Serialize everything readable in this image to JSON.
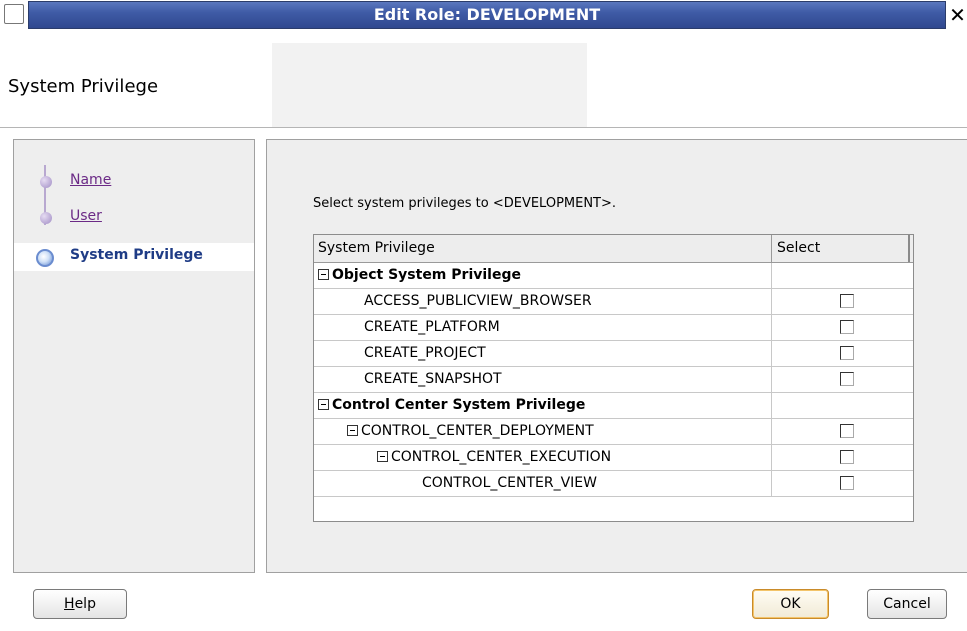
{
  "window": {
    "title": "Edit Role: DEVELOPMENT",
    "close_glyph": "✕"
  },
  "header": {
    "heading": "System Privilege"
  },
  "nav": {
    "items": [
      {
        "label": "Name",
        "state": "visited"
      },
      {
        "label": "User",
        "state": "visited"
      },
      {
        "label": "System Privilege",
        "state": "active"
      }
    ]
  },
  "main": {
    "instruction": "Select system privileges to <DEVELOPMENT>."
  },
  "table": {
    "columns": [
      "System Privilege",
      "Select"
    ],
    "rows": [
      {
        "label": "Object System Privilege",
        "level": 0,
        "group": true,
        "checkbox": false,
        "checked": false
      },
      {
        "label": "ACCESS_PUBLICVIEW_BROWSER",
        "level": 1,
        "group": false,
        "checkbox": true,
        "checked": false
      },
      {
        "label": "CREATE_PLATFORM",
        "level": 1,
        "group": false,
        "checkbox": true,
        "checked": false
      },
      {
        "label": "CREATE_PROJECT",
        "level": 1,
        "group": false,
        "checkbox": true,
        "checked": false
      },
      {
        "label": "CREATE_SNAPSHOT",
        "level": 1,
        "group": false,
        "checkbox": true,
        "checked": false
      },
      {
        "label": "Control Center System Privilege",
        "level": 0,
        "group": true,
        "checkbox": false,
        "checked": false
      },
      {
        "label": "CONTROL_CENTER_DEPLOYMENT",
        "level": 1,
        "group": true,
        "checkbox": true,
        "checked": false
      },
      {
        "label": "CONTROL_CENTER_EXECUTION",
        "level": 2,
        "group": true,
        "checkbox": true,
        "checked": false
      },
      {
        "label": "CONTROL_CENTER_VIEW",
        "level": 3,
        "group": false,
        "checkbox": true,
        "checked": false
      }
    ]
  },
  "buttons": {
    "help": {
      "mnemonic": "H",
      "rest": "elp"
    },
    "ok": "OK",
    "cancel": "Cancel"
  },
  "colors": {
    "titlebar": "#3f5ba6",
    "nav_link": "#6b2a86",
    "nav_active": "#1f3c86",
    "default_button_border": "#c98b2a"
  }
}
